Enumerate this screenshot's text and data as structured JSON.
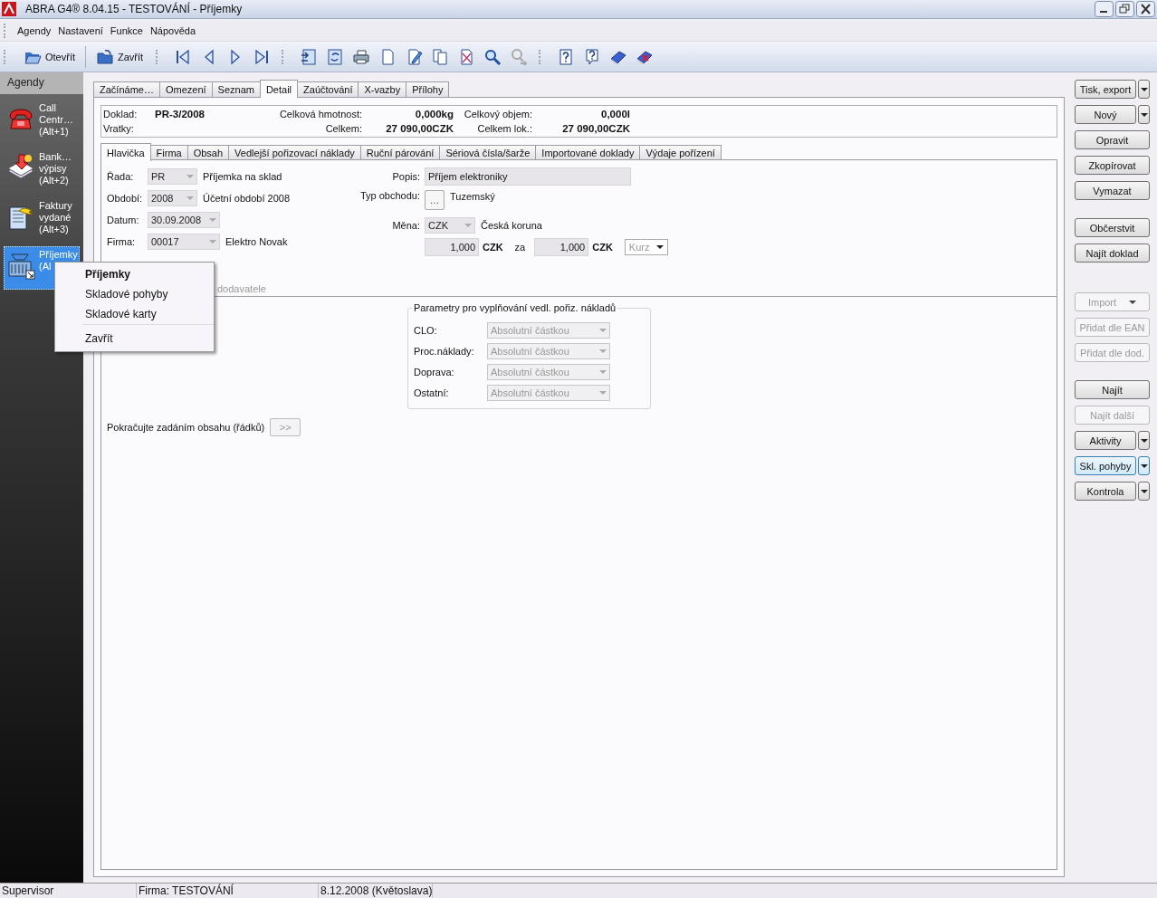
{
  "window": {
    "title": "ABRA G4® 8.04.15 - TESTOVÁNÍ - Příjemky"
  },
  "menu": [
    "Agendy",
    "Nastavení",
    "Funkce",
    "Nápověda"
  ],
  "toolbar": [
    [
      {
        "kind": "open",
        "label": "Otevřít",
        "disabled": false
      },
      {
        "kind": "close",
        "label": "Zavřít",
        "disabled": false
      }
    ],
    [
      {
        "kind": "first",
        "disabled": false
      },
      {
        "kind": "prev",
        "disabled": false
      },
      {
        "kind": "next",
        "disabled": false
      },
      {
        "kind": "last",
        "disabled": false
      }
    ],
    [
      {
        "kind": "import",
        "disabled": false
      },
      {
        "kind": "refresh",
        "disabled": false
      },
      {
        "kind": "print",
        "disabled": false
      },
      {
        "kind": "new",
        "disabled": false
      },
      {
        "kind": "edit",
        "disabled": false
      },
      {
        "kind": "copy",
        "disabled": false
      },
      {
        "kind": "delete",
        "disabled": false
      },
      {
        "kind": "search",
        "disabled": false
      },
      {
        "kind": "search-next",
        "disabled": true
      }
    ],
    [
      {
        "kind": "help",
        "disabled": false
      },
      {
        "kind": "context-help",
        "disabled": false
      },
      {
        "kind": "book",
        "disabled": false
      },
      {
        "kind": "book-x",
        "disabled": false
      }
    ]
  ],
  "sidebar": {
    "title": "Agendy",
    "items": [
      {
        "kind": "phone",
        "lines": [
          "Call",
          "Centr…",
          "(Alt+1)"
        ],
        "selected": false
      },
      {
        "kind": "bank",
        "lines": [
          "Bank…",
          "výpisy",
          "(Alt+2)"
        ],
        "selected": false
      },
      {
        "kind": "invoice",
        "lines": [
          "Faktury",
          "vydané",
          "(Alt+3)"
        ],
        "selected": false
      },
      {
        "kind": "receipt",
        "lines": [
          "Příjemky",
          "(Al"
        ],
        "selected": true
      }
    ]
  },
  "tabs": [
    {
      "label": "Začínáme…",
      "selected": false
    },
    {
      "label": "Omezení",
      "selected": false
    },
    {
      "label": "Seznam",
      "selected": false
    },
    {
      "label": "Detail",
      "selected": true
    },
    {
      "label": "Zaúčtování",
      "selected": false
    },
    {
      "label": "X-vazby",
      "selected": false
    },
    {
      "label": "Přílohy",
      "selected": false
    }
  ],
  "summary": [
    [
      {
        "label": "Doklad:",
        "value": "PR-3/2008"
      },
      {
        "label": "Celková hmotnost:",
        "value": "0,000kg"
      },
      {
        "label": "Celkový objem:",
        "value": "0,000l"
      }
    ],
    [
      {
        "label": "Vratky:"
      },
      {
        "label": "Celkem:",
        "value": "27 090,00CZK"
      },
      {
        "label": "Celkem lok.:",
        "value": "27 090,00CZK"
      }
    ]
  ],
  "subtabs": [
    {
      "label": "Hlavička",
      "selected": true
    },
    {
      "label": "Firma",
      "selected": false
    },
    {
      "label": "Obsah",
      "selected": false
    },
    {
      "label": "Vedlejší pořizovací náklady",
      "selected": false
    },
    {
      "label": "Ruční párování",
      "selected": false
    },
    {
      "label": "Sériová čísla/šarže",
      "selected": false
    },
    {
      "label": "Importované doklady",
      "selected": false
    },
    {
      "label": "Výdaje pořízení",
      "selected": false
    }
  ],
  "form": {
    "left": [
      {
        "label": "Řada:",
        "value": "PR",
        "note": "Příjemka na sklad"
      },
      {
        "label": "Období:",
        "value": "2008",
        "note": "Účetní období 2008"
      },
      {
        "label": "Datum:",
        "value": "30.09.2008"
      },
      {
        "label": "Firma:",
        "value": "00017",
        "note": "Elektro Novak"
      }
    ],
    "partial_note": "dodavatele",
    "popis": {
      "label": "Popis:",
      "value": "Příjem elektroniky"
    },
    "typ_obchodu": {
      "label": "Typ obchodu:",
      "button": "…",
      "note": "Tuzemský"
    },
    "mena": {
      "label": "Měna:",
      "value": "CZK",
      "note": "Česká koruna"
    },
    "rate": {
      "amount": "1,000",
      "currency": "CZK",
      "word": "za",
      "amount2": "1,000",
      "currency2": "CZK",
      "kurz": "Kurz"
    }
  },
  "params": {
    "title": "Parametry pro vyplňování vedl. pořiz. nákladů",
    "rows": [
      {
        "label": "CLO:",
        "value": "Absolutní částkou"
      },
      {
        "label": "Proc.náklady:",
        "value": "Absolutní částkou"
      },
      {
        "label": "Doprava:",
        "value": "Absolutní částkou"
      },
      {
        "label": "Ostatní:",
        "value": "Absolutní částkou"
      }
    ]
  },
  "continue": {
    "text": "Pokračujte zadáním obsahu (řádků)",
    "button": ">>"
  },
  "actions": [
    [
      {
        "label": "Tisk, export",
        "kind": "split",
        "disabled": false,
        "focused": false
      },
      {
        "label": "Nový",
        "kind": "split",
        "disabled": false,
        "focused": false
      },
      {
        "label": "Opravit",
        "kind": "plain",
        "disabled": false,
        "focused": false
      },
      {
        "label": "Zkopírovat",
        "kind": "plain",
        "disabled": false,
        "focused": false
      },
      {
        "label": "Vymazat",
        "kind": "plain",
        "disabled": false,
        "focused": false
      }
    ],
    [
      {
        "label": "Občerstvit",
        "kind": "plain",
        "disabled": false,
        "focused": false
      },
      {
        "label": "Najít doklad",
        "kind": "plain",
        "disabled": false,
        "focused": false
      }
    ],
    [
      {
        "label": "Import",
        "kind": "dropdown",
        "disabled": true,
        "focused": false
      },
      {
        "label": "Přidat dle EAN",
        "kind": "plain",
        "disabled": true,
        "focused": false
      },
      {
        "label": "Přidat dle dod.",
        "kind": "plain",
        "disabled": true,
        "focused": false
      }
    ],
    [
      {
        "label": "Najít",
        "kind": "plain",
        "disabled": false,
        "focused": false
      },
      {
        "label": "Najít další",
        "kind": "plain",
        "disabled": true,
        "focused": false
      },
      {
        "label": "Aktivity",
        "kind": "split",
        "disabled": false,
        "focused": false
      },
      {
        "label": "Skl. pohyby",
        "kind": "split",
        "disabled": false,
        "focused": true
      },
      {
        "label": "Kontrola",
        "kind": "split",
        "disabled": false,
        "focused": false
      }
    ]
  ],
  "context_menu": {
    "items": [
      {
        "label": "Příjemky",
        "default": true,
        "separator_before": false
      },
      {
        "label": "Skladové pohyby",
        "default": false,
        "separator_before": false
      },
      {
        "label": "Skladové karty",
        "default": false,
        "separator_before": false
      },
      {
        "label": "Zavřít",
        "default": false,
        "separator_before": true
      }
    ]
  },
  "status_bar": [
    "Supervisor",
    "Firma: TESTOVÁNÍ",
    "8.12.2008 (Květoslava)"
  ]
}
